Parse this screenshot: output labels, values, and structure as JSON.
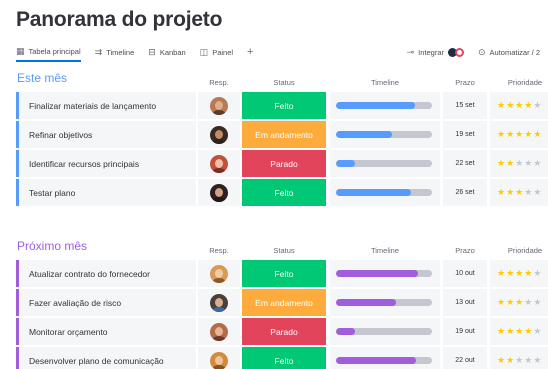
{
  "page": {
    "title": "Panorama do projeto"
  },
  "toolbar": {
    "tabs": [
      {
        "label": "Tabela principal",
        "icon": "table-icon",
        "glyph": "▦",
        "active": true
      },
      {
        "label": "Timeline",
        "icon": "timeline-icon",
        "glyph": "⇉",
        "active": false
      },
      {
        "label": "Kanban",
        "icon": "kanban-icon",
        "glyph": "⊟",
        "active": false
      },
      {
        "label": "Painel",
        "icon": "dashboard-icon",
        "glyph": "◫",
        "active": false
      }
    ],
    "add_tab": "+",
    "integrar_label": "Integrar",
    "integrar_icon": "⊸",
    "automatizar_label": "Automatizar / 2",
    "automatizar_icon": "⊙"
  },
  "columns": {
    "resp": "Resp.",
    "status": "Status",
    "timeline": "Timeline",
    "prazo": "Prazo",
    "prioridade": "Prioridade"
  },
  "colors": {
    "done": "#00c875",
    "working": "#fdab3d",
    "stuck": "#e2445c",
    "blue_group": "#579bfc",
    "purple_group": "#a25ddc",
    "star_on": "#ffcb00",
    "star_off": "#c5c7d0"
  },
  "groups": [
    {
      "title": "Este mês",
      "color": "#579bfc",
      "rows": [
        {
          "name": "Finalizar materiais de lançamento",
          "status": "Feito",
          "status_color": "#00c875",
          "progress": 0.82,
          "prazo": "15 set",
          "stars": 4,
          "avatar_bg": "#b77a56",
          "avatar_skin": "#e0ad89",
          "avatar_shirt": "#5a3d2b"
        },
        {
          "name": "Refinar objetivos",
          "status": "Em andamento",
          "status_color": "#fdab3d",
          "progress": 0.58,
          "prazo": "19 set",
          "stars": 5,
          "avatar_bg": "#3a2a22",
          "avatar_skin": "#c28b6a",
          "avatar_shirt": "#2b2222"
        },
        {
          "name": "Identificar recursos principais",
          "status": "Parado",
          "status_color": "#e2445c",
          "progress": 0.2,
          "prazo": "22 set",
          "stars": 2,
          "avatar_bg": "#c1513d",
          "avatar_skin": "#f0c2a5",
          "avatar_shirt": "#7a2f25"
        },
        {
          "name": "Testar plano",
          "status": "Feito",
          "status_color": "#00c875",
          "progress": 0.78,
          "prazo": "26 set",
          "stars": 3,
          "avatar_bg": "#2e2020",
          "avatar_skin": "#d4a184",
          "avatar_shirt": "#221818"
        }
      ]
    },
    {
      "title": "Próximo mês",
      "color": "#a25ddc",
      "rows": [
        {
          "name": "Atualizar contrato do fornecedor",
          "status": "Feito",
          "status_color": "#00c875",
          "progress": 0.85,
          "prazo": "10 out",
          "stars": 4,
          "avatar_bg": "#d99a55",
          "avatar_skin": "#f3caa4",
          "avatar_shirt": "#8a5a2b"
        },
        {
          "name": "Fazer avaliação de risco",
          "status": "Em andamento",
          "status_color": "#fdab3d",
          "progress": 0.62,
          "prazo": "13 out",
          "stars": 3,
          "avatar_bg": "#4a3f3a",
          "avatar_skin": "#d9b08f",
          "avatar_shirt": "#3a6aa8"
        },
        {
          "name": "Monitorar orçamento",
          "status": "Parado",
          "status_color": "#e2445c",
          "progress": 0.2,
          "prazo": "19 out",
          "stars": 4,
          "avatar_bg": "#b56a4c",
          "avatar_skin": "#e7b594",
          "avatar_shirt": "#6b3b2a"
        },
        {
          "name": "Desenvolver plano de comunicação",
          "status": "Feito",
          "status_color": "#00c875",
          "progress": 0.83,
          "prazo": "22 out",
          "stars": 2,
          "avatar_bg": "#d18b3e",
          "avatar_skin": "#f0c39b",
          "avatar_shirt": "#8a4f22"
        }
      ]
    }
  ]
}
